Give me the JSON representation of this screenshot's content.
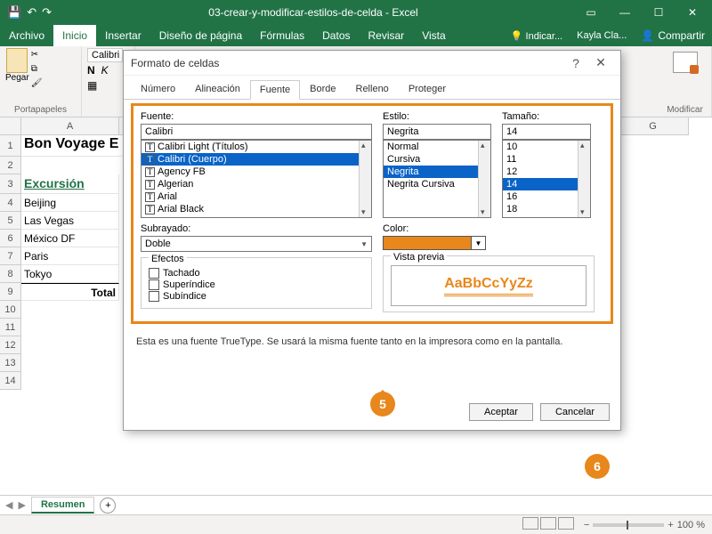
{
  "titlebar": {
    "title": "03-crear-y-modificar-estilos-de-celda - Excel"
  },
  "ribbon": {
    "tabs": [
      "Archivo",
      "Inicio",
      "Insertar",
      "Diseño de página",
      "Fórmulas",
      "Datos",
      "Revisar",
      "Vista"
    ],
    "active": "Inicio",
    "tell_me": "Indicar...",
    "user": "Kayla Cla...",
    "share": "Compartir",
    "clipboard_label": "Portapapeles",
    "paste_label": "Pegar",
    "font_name": "Calibri",
    "modify_label": "Modificar"
  },
  "columns": [
    "A",
    "G"
  ],
  "rows": [
    "1",
    "2",
    "3",
    "4",
    "5",
    "6",
    "7",
    "8",
    "9",
    "10",
    "11",
    "12",
    "13",
    "14"
  ],
  "cellsA": {
    "a1": "Bon Voyage E",
    "a3": "Excursión",
    "a4": "Beijing",
    "a5": "Las Vegas",
    "a6": "México DF",
    "a7": "Paris",
    "a8": "Tokyo",
    "a9": "Total"
  },
  "sheet": {
    "name": "Resumen"
  },
  "status": {
    "zoom": "100 %"
  },
  "dialog": {
    "title": "Formato de celdas",
    "tabs": [
      "Número",
      "Alineación",
      "Fuente",
      "Borde",
      "Relleno",
      "Proteger"
    ],
    "active_tab": "Fuente",
    "font_label": "Fuente:",
    "font_value": "Calibri",
    "font_list": [
      "Calibri Light (Títulos)",
      "Calibri (Cuerpo)",
      "Agency FB",
      "Algerian",
      "Arial",
      "Arial Black"
    ],
    "font_selected": "Calibri (Cuerpo)",
    "style_label": "Estilo:",
    "style_value": "Negrita",
    "style_list": [
      "Normal",
      "Cursiva",
      "Negrita",
      "Negrita Cursiva"
    ],
    "style_selected": "Negrita",
    "size_label": "Tamaño:",
    "size_value": "14",
    "size_list": [
      "10",
      "11",
      "12",
      "14",
      "16",
      "18"
    ],
    "size_selected": "14",
    "underline_label": "Subrayado:",
    "underline_value": "Doble",
    "color_label": "Color:",
    "color_hex": "#e8871b",
    "effects_label": "Efectos",
    "eff_strike": "Tachado",
    "eff_super": "Superíndice",
    "eff_sub": "Subíndice",
    "preview_label": "Vista previa",
    "preview_text": "AaBbCcYyZz",
    "info": "Esta es una fuente TrueType. Se usará la misma fuente tanto en la impresora como en la pantalla.",
    "ok": "Aceptar",
    "cancel": "Cancelar"
  },
  "callouts": {
    "five": "5",
    "six": "6"
  }
}
